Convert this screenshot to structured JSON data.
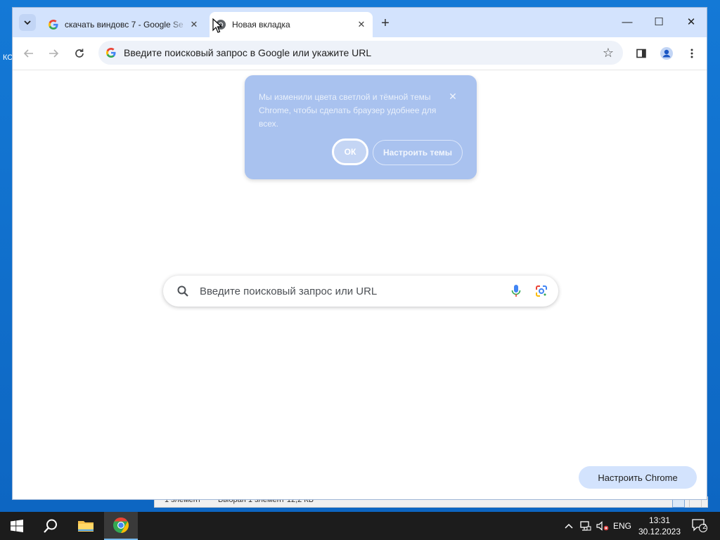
{
  "desktop": {
    "label": "КС"
  },
  "background_window": {
    "status_left": "1 элемент",
    "status_mid": "Выбран 1 элемент 12,2 КБ"
  },
  "browser": {
    "tabs": [
      {
        "title": "скачать виндовс 7 - Google Se",
        "favicon": "google-g-icon"
      },
      {
        "title": "Новая вкладка",
        "favicon": "chrome-icon"
      }
    ],
    "new_tab": "+",
    "window_controls": {
      "minimize": "—",
      "maximize": "☐",
      "close": "✕"
    },
    "omnibox": {
      "placeholder": "Введите поисковый запрос в Google или укажите URL"
    }
  },
  "popup": {
    "message": "Мы изменили цвета светлой и тёмной темы Chrome, чтобы сделать браузер удобнее для всех.",
    "ok_label": "ОК",
    "themes_label": "Настроить темы"
  },
  "search": {
    "placeholder": "Введите поисковый запрос или URL"
  },
  "customize_label": "Настроить Chrome",
  "taskbar": {
    "lang": "ENG",
    "time": "13:31",
    "date": "30.12.2023",
    "notifications": "2"
  },
  "colors": {
    "accent": "#d3e3fd",
    "taskbar": "#1c1c1c",
    "desktop": "#0d66c2"
  }
}
